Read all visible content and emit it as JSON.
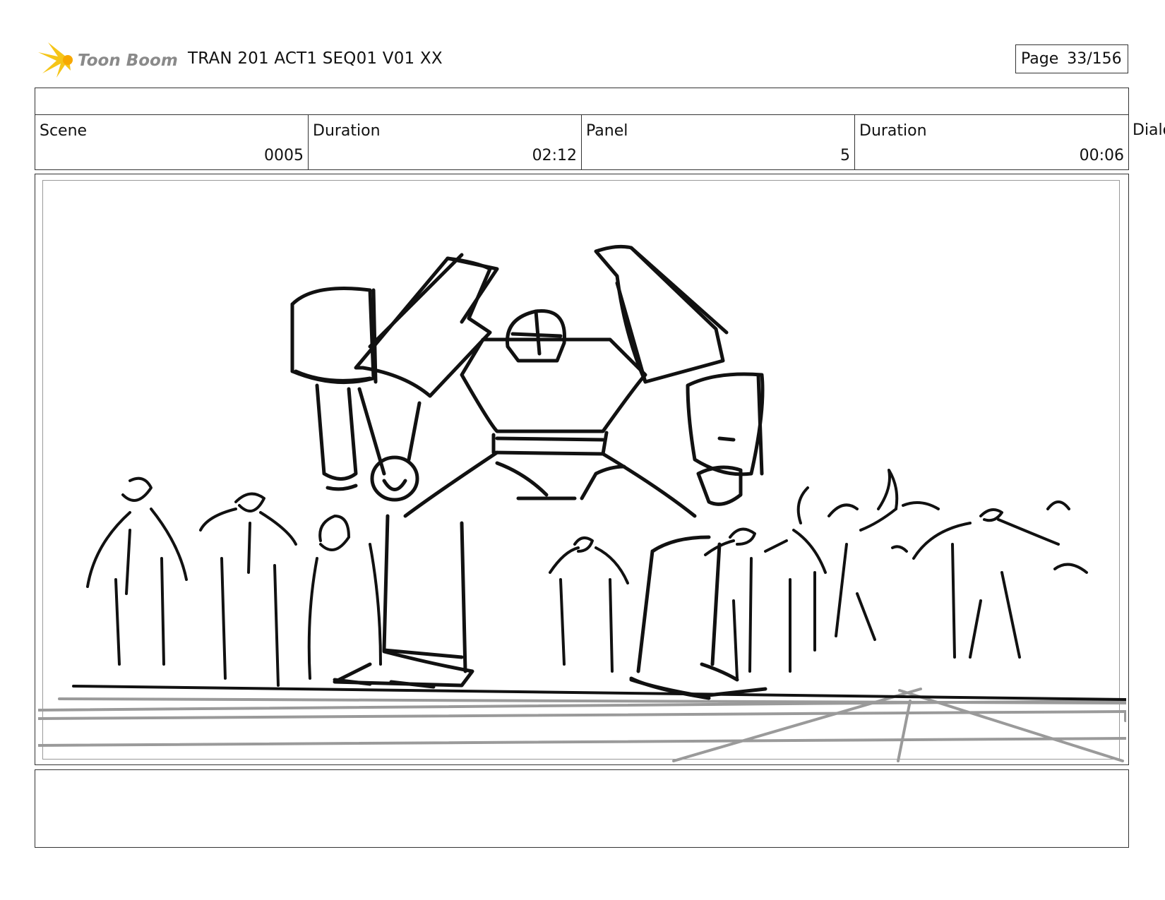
{
  "header": {
    "brand": "Toon Boom",
    "doc_title": "TRAN 201 ACT1 SEQ01 V01 XX",
    "page_label": "Page",
    "page_number": "33/156"
  },
  "info": {
    "scene_label": "Scene",
    "scene_value": "0005",
    "scene_duration_label": "Duration",
    "scene_duration_value": "02:12",
    "panel_label": "Panel",
    "panel_value": "5",
    "panel_duration_label": "Duration",
    "panel_duration_value": "00:06",
    "dialog_label": "Dialo"
  },
  "colors": {
    "logo_star": "#f5c518",
    "logo_text": "#8a8a8a",
    "ink": "#111111",
    "floor_lines": "#9a9a9a"
  }
}
